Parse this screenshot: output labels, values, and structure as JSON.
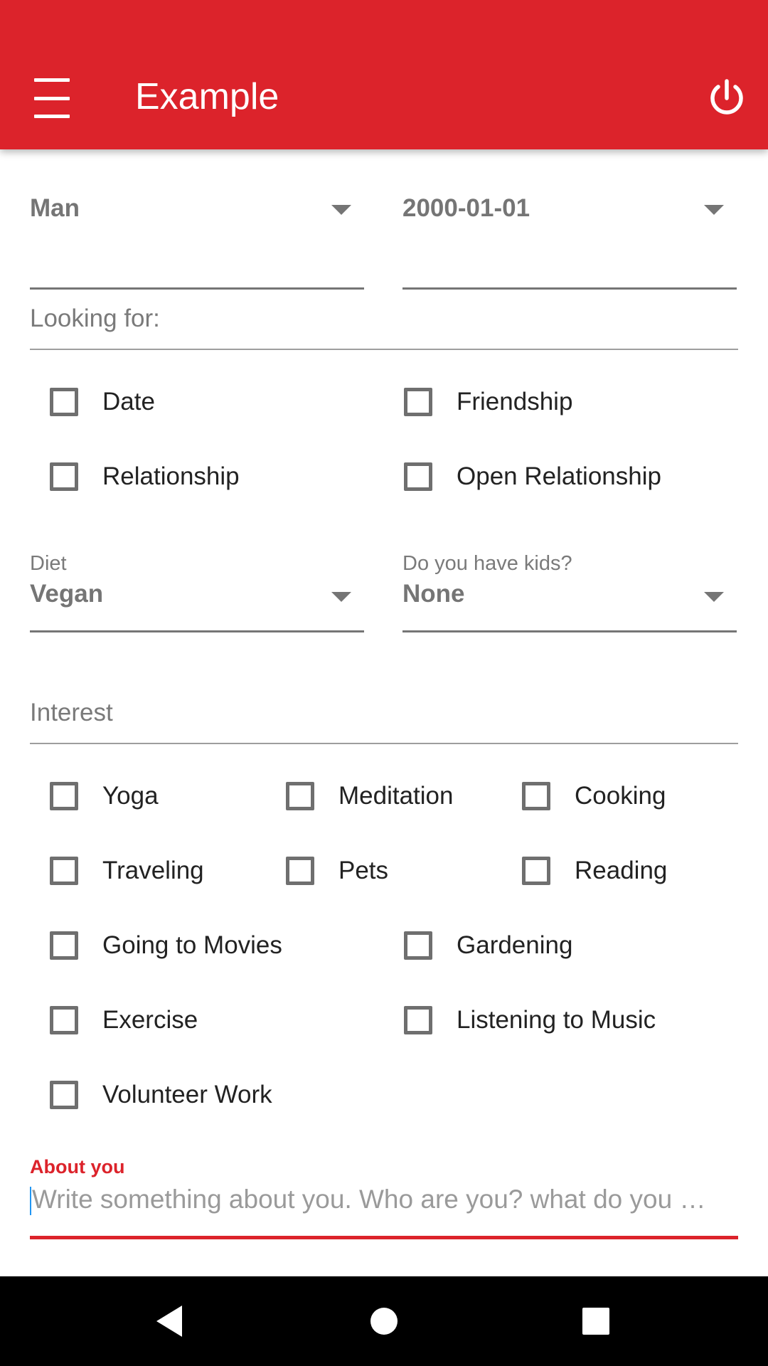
{
  "header": {
    "title": "Example",
    "menu_icon": "hamburger-menu-icon",
    "power_icon": "power-icon",
    "color": "#dc232b"
  },
  "fields_top": {
    "gender_value": "Man",
    "birthday_value": "2000-01-01"
  },
  "looking_for": {
    "title": "Looking for:",
    "options": [
      "Date",
      "Friendship",
      "Relationship",
      "Open Relationship"
    ]
  },
  "diet": {
    "label": "Diet",
    "value": "Vegan"
  },
  "kids": {
    "label": "Do you have kids?",
    "value": "None"
  },
  "interest": {
    "title": "Interest",
    "options": [
      "Yoga",
      "Meditation",
      "Cooking",
      "Traveling",
      "Pets",
      "Reading",
      "Going to Movies",
      "Gardening",
      "Exercise",
      "Listening to Music",
      "Volunteer Work"
    ]
  },
  "about": {
    "label": "About you",
    "placeholder": "Write something about you. Who are you? what do you …",
    "accent": "#dc232b"
  },
  "navbar": {
    "back_icon": "back-triangle-icon",
    "home_icon": "home-circle-icon",
    "recents_icon": "recents-square-icon"
  }
}
